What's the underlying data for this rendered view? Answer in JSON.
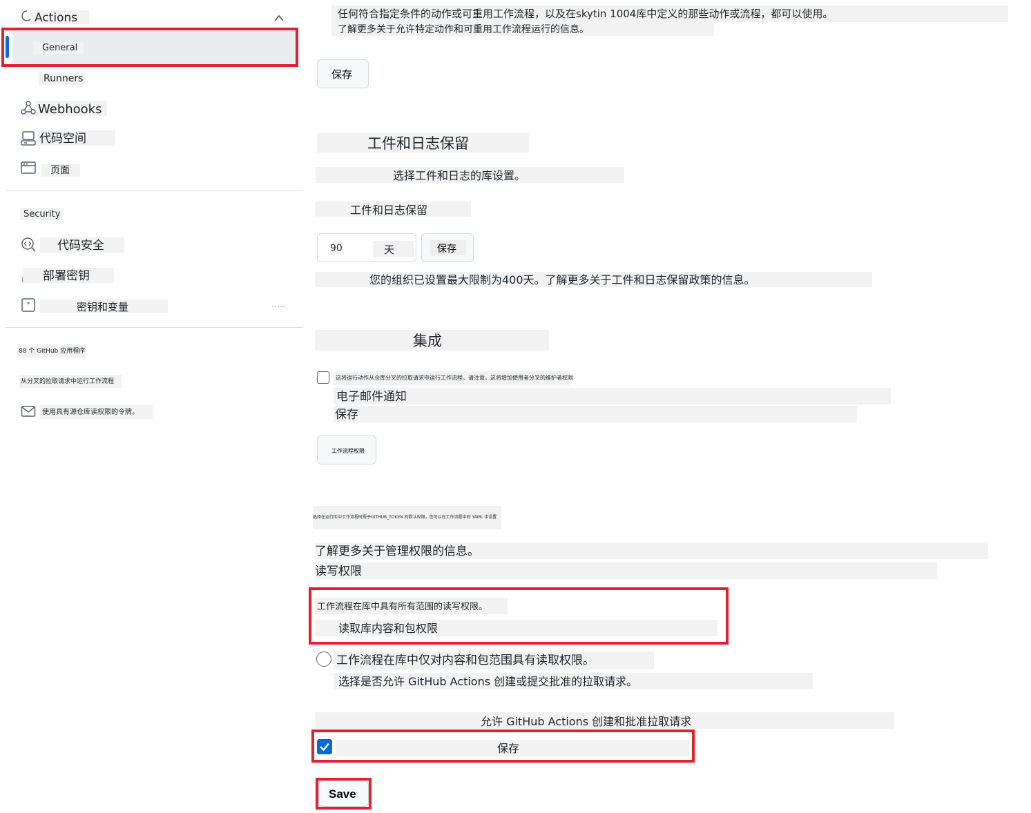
{
  "sidebar": {
    "actions_label": "Actions",
    "general_label": "General",
    "runners_label": "Runners",
    "webhooks_label": "Webhooks",
    "codespaces_label": "代码空间",
    "pages_label": "页面",
    "security_heading": "Security",
    "code_security_label": "代码安全",
    "deploy_keys_label": "部署密钥",
    "secrets_label": "密钥和变量",
    "github_apps_label": "88 个 GitHub 应用程序",
    "fork_pr_label": "从分叉的拉取请求中运行工作流程",
    "email_label": "使用具有源仓库读权限的令牌。"
  },
  "main": {
    "intro_line1": "任何符合指定条件的动作或可重用工作流程，以及在skytin 1004库中定义的那些动作或流程，都可以使用。",
    "intro_line2": "了解更多关于允许特定动作和可重用工作流程运行的信息。",
    "save_button_1": "保存",
    "artifacts_heading": "工件和日志保留",
    "artifacts_desc": "选择工件和日志的库设置。",
    "artifacts_field_label": "工件和日志保留",
    "retention_value": "90",
    "retention_unit": "天",
    "save_button_2": "保存",
    "retention_note": "您的组织已设置最大限制为400天。了解更多关于工件和日志保留政策的信息。",
    "integration_heading": "集成",
    "fork_checkbox_label": "这将运行动作从仓库分叉的拉取请求中运行工作流程，请注意，这将增加使用者分叉的维护者权限",
    "email_notification": "电子邮件通知",
    "save_text": "保存",
    "workflow_permissions_button": "工作流程权限",
    "permissions_desc": "选择在运行库中工作流程时授予GITHUB_TOKEN 的默认权限，您可以在工作流程中的 YAML 中设置",
    "learn_permissions": "了解更多关于管理权限的信息。",
    "read_write_label": "读写权限",
    "read_write_desc": "工作流程在库中具有所有范围的读写权限。",
    "read_content_label": "读取库内容和包权限",
    "read_only_desc": "工作流程在库中仅对内容和包范围具有读取权限。",
    "pr_question": "选择是否允许 GitHub Actions 创建或提交批准的拉取请求。",
    "allow_pr_label": "允许 GitHub Actions 创建和批准拉取请求",
    "allow_pr_save": "保存",
    "final_save": "Save"
  },
  "colors": {
    "highlight_red": "#e3202e",
    "accent_blue": "#0969da",
    "text_bg": "#f2f2f2"
  }
}
